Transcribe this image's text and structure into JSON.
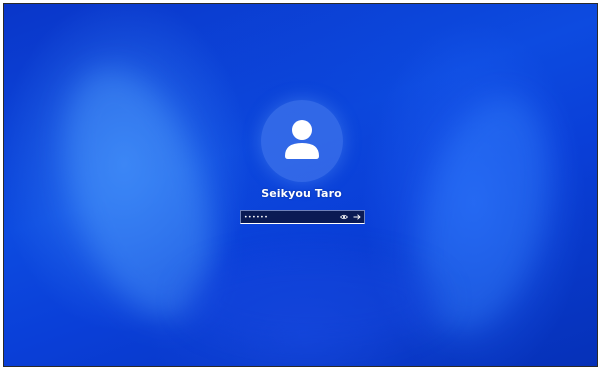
{
  "lock_screen": {
    "user": {
      "name": "Seikyou Taro",
      "avatar_icon": "user-icon"
    },
    "password": {
      "value": "••••••",
      "reveal_icon": "eye-icon",
      "submit_icon": "arrow-right-icon"
    },
    "colors": {
      "background": "#0a3fd8",
      "accent": "#4d9bff",
      "text": "#ffffff"
    }
  }
}
